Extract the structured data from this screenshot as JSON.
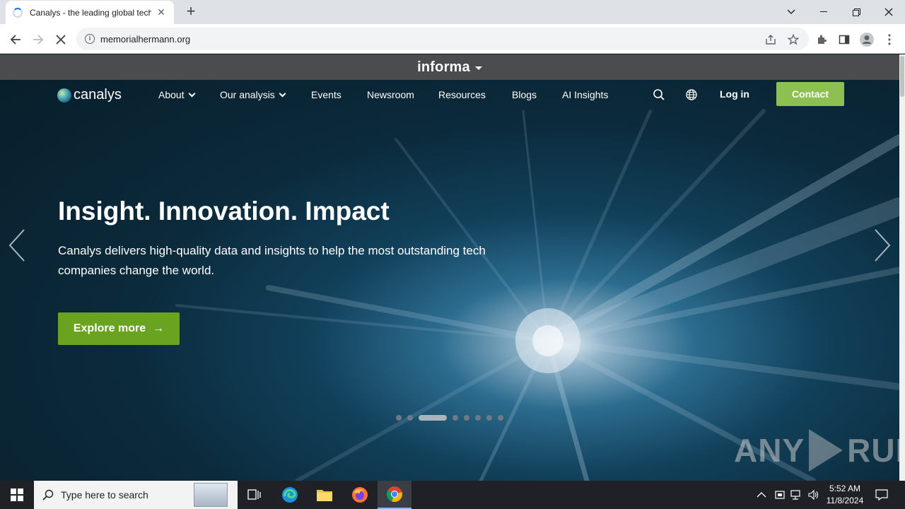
{
  "browser": {
    "tab_title": "Canalys - the leading global tech",
    "new_tab": "+",
    "url": "memorialhermann.org"
  },
  "informa": {
    "label": "informa"
  },
  "nav": {
    "logo": "canalys",
    "items": [
      {
        "label": "About",
        "dropdown": true
      },
      {
        "label": "Our analysis",
        "dropdown": true
      },
      {
        "label": "Events"
      },
      {
        "label": "Newsroom"
      },
      {
        "label": "Resources"
      },
      {
        "label": "Blogs"
      },
      {
        "label": "AI Insights"
      }
    ],
    "login": "Log in",
    "contact": "Contact"
  },
  "hero": {
    "title": "Insight. Innovation. Impact",
    "subtitle": "Canalys delivers high-quality data and insights to help the most outstanding tech companies change the world.",
    "cta": "Explore more",
    "cta_arrow": "→",
    "slides_total": 8,
    "slide_active": 3
  },
  "watermark": {
    "left": "ANY",
    "right": "RUN"
  },
  "taskbar": {
    "search_placeholder": "Type here to search",
    "time": "5:52 AM",
    "date": "11/8/2024"
  },
  "colors": {
    "contact_green": "#8cc152",
    "explore_green": "#6aa31f",
    "informa_bar": "#4a4c4d"
  }
}
